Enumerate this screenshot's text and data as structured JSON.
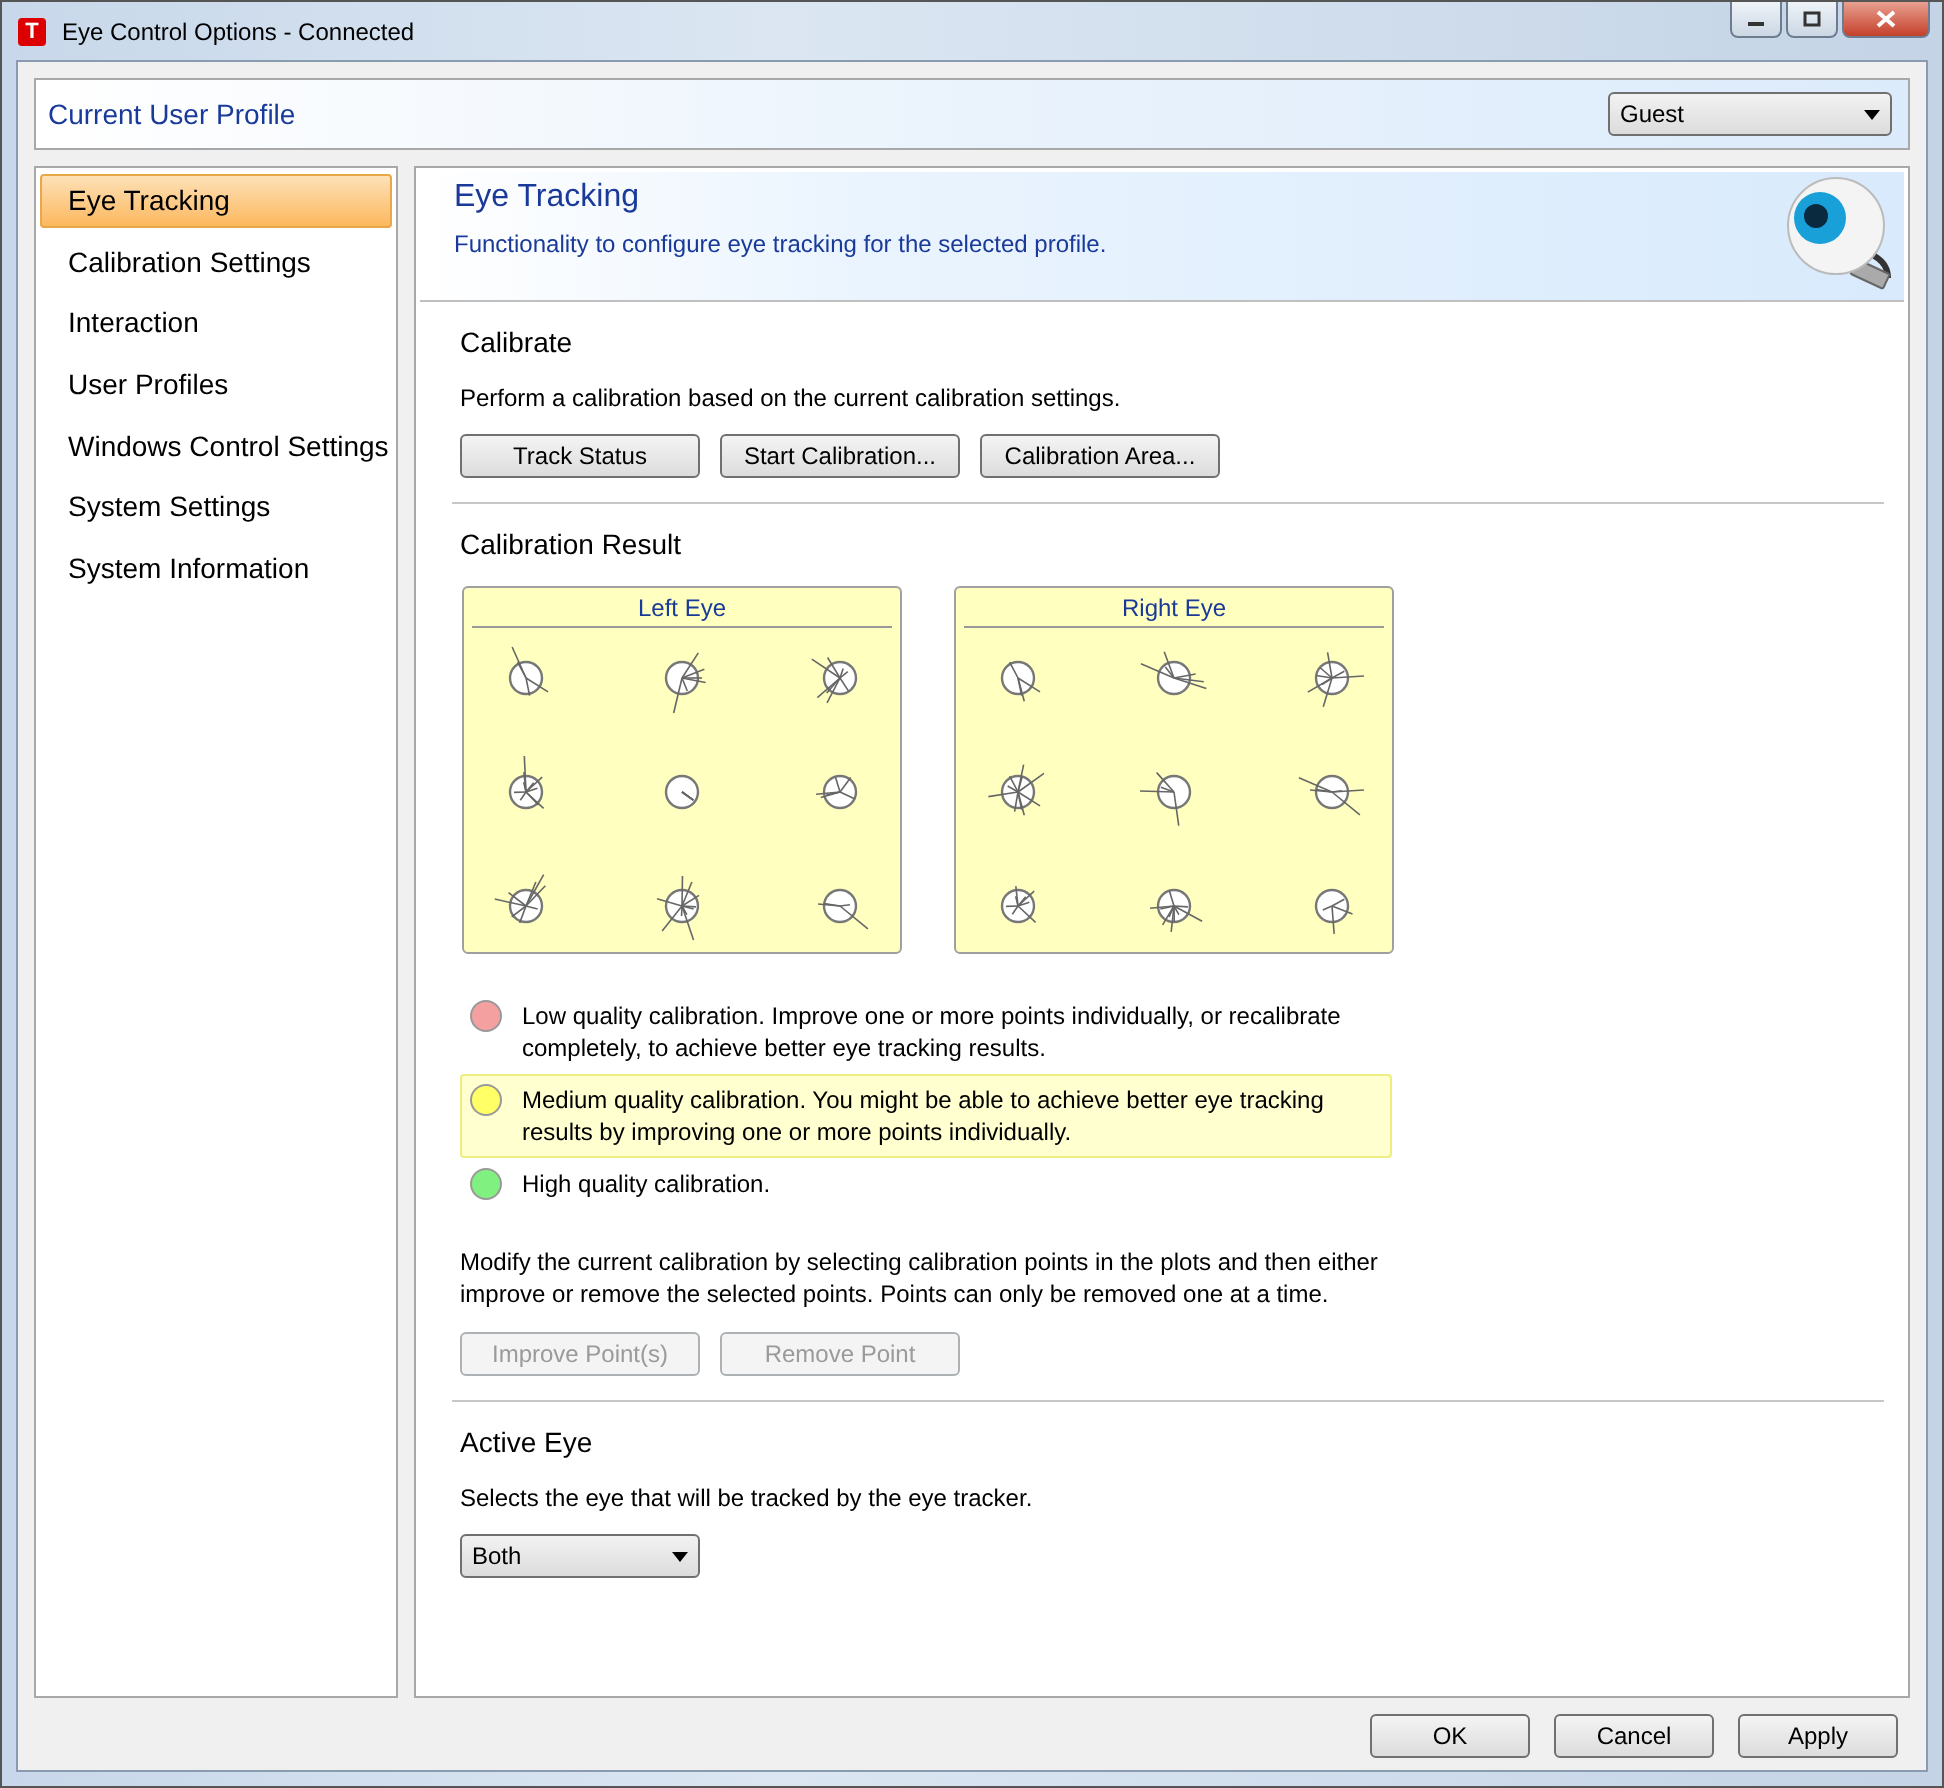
{
  "window": {
    "app_icon": "T",
    "title": "Eye Control Options - Connected"
  },
  "profile": {
    "label": "Current User Profile",
    "value": "Guest"
  },
  "sidebar": {
    "items": [
      {
        "label": "Eye Tracking",
        "selected": true
      },
      {
        "label": "Calibration Settings",
        "selected": false
      },
      {
        "label": "Interaction",
        "selected": false
      },
      {
        "label": "User Profiles",
        "selected": false
      },
      {
        "label": "Windows Control Settings",
        "selected": false
      },
      {
        "label": "System Settings",
        "selected": false
      },
      {
        "label": "System Information",
        "selected": false
      }
    ]
  },
  "header": {
    "title": "Eye Tracking",
    "subtitle": "Functionality to configure eye tracking for the selected profile."
  },
  "calibrate": {
    "heading": "Calibrate",
    "text": "Perform a calibration based on the current calibration settings.",
    "buttons": [
      {
        "label": "Track Status",
        "disabled": false
      },
      {
        "label": "Start Calibration...",
        "disabled": false
      },
      {
        "label": "Calibration Area...",
        "disabled": false
      }
    ]
  },
  "calibration_result": {
    "heading": "Calibration Result",
    "plots": [
      {
        "title": "Left Eye"
      },
      {
        "title": "Right Eye"
      }
    ],
    "legend": [
      {
        "text": "Low quality calibration. Improve one or more points individually, or recalibrate completely, to achieve better eye tracking results.",
        "color": "#f4a0a0",
        "selected": false
      },
      {
        "text": "Medium quality calibration. You might be able to achieve better eye tracking results by improving one or more points individually.",
        "color": "#ffff66",
        "selected": true
      },
      {
        "text": "High quality calibration.",
        "color": "#80f080",
        "selected": false
      }
    ],
    "note": "Modify the current calibration by selecting calibration points in the plots and then either improve or remove the selected points. Points can only be removed one at a time.",
    "buttons": [
      {
        "label": "Improve Point(s)",
        "disabled": true
      },
      {
        "label": "Remove Point",
        "disabled": true
      }
    ]
  },
  "active_eye": {
    "heading": "Active Eye",
    "text": "Selects the eye that will be tracked by the eye tracker.",
    "value": "Both"
  },
  "footer_buttons": [
    {
      "label": "OK",
      "disabled": false
    },
    {
      "label": "Cancel",
      "disabled": false
    },
    {
      "label": "Apply",
      "disabled": false
    }
  ]
}
